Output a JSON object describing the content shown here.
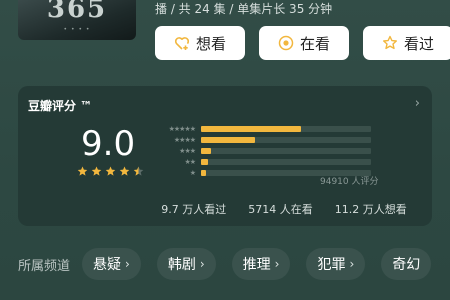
{
  "poster": {
    "title": "365",
    "subtitle": "• • • •"
  },
  "meta": {
    "text": "播 / 共 24 集 / 单集片长 35 分钟"
  },
  "actions": [
    {
      "label": "想看",
      "icon": "heart-plus-icon"
    },
    {
      "label": "在看",
      "icon": "target-circle-icon"
    },
    {
      "label": "看过",
      "icon": "star-outline-icon"
    }
  ],
  "rating": {
    "title": "豆瓣评分 ™",
    "score": "9.0",
    "stars": 4.5,
    "star_color": "#f2b73e",
    "distribution": [
      {
        "stars": "★★★★★",
        "fraction": 0.59
      },
      {
        "stars": "★★★★",
        "fraction": 0.32
      },
      {
        "stars": "★★★",
        "fraction": 0.06
      },
      {
        "stars": "★★",
        "fraction": 0.04
      },
      {
        "stars": "★",
        "fraction": 0.03
      }
    ],
    "count": "94910 人评分",
    "stats": [
      "9.7 万人看过",
      "5714 人在看",
      "11.2 万人想看"
    ]
  },
  "channels": {
    "label": "所属频道",
    "items": [
      "悬疑",
      "韩剧",
      "推理",
      "犯罪",
      "奇幻"
    ]
  },
  "colors": {
    "background": "#2f4a44",
    "card": "#243a36",
    "accent": "#f2b73e",
    "chip": "#3a524d"
  }
}
